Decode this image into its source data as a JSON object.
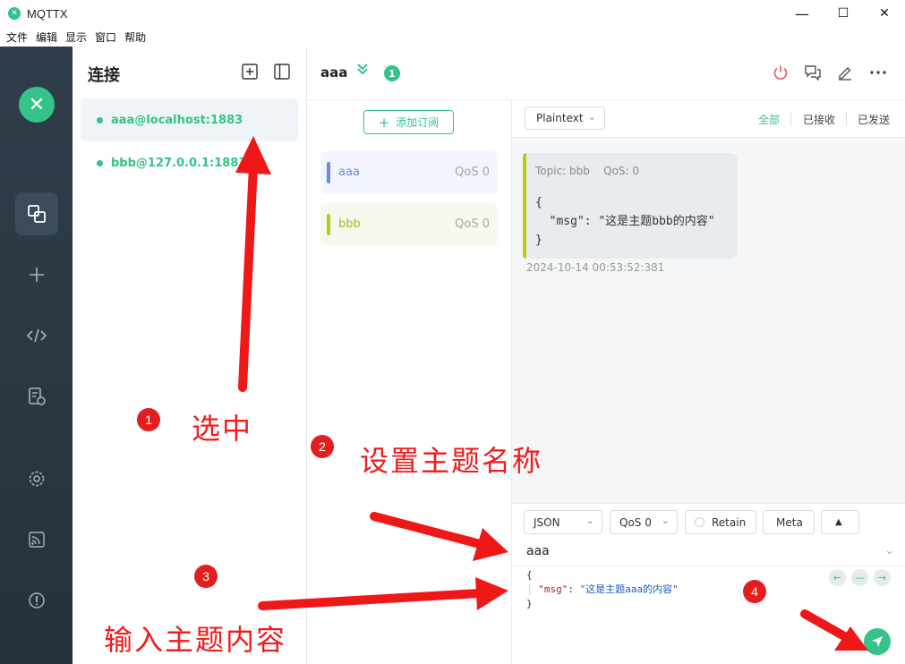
{
  "window": {
    "title": "MQTTX",
    "minimize": "—",
    "maximize": "☐",
    "close": "✕"
  },
  "menu": [
    "文件",
    "编辑",
    "显示",
    "窗口",
    "帮助"
  ],
  "nav": {
    "logo": "✕",
    "items": [
      "connections-icon",
      "plus-icon",
      "code-icon",
      "log-icon",
      "gear-icon",
      "rss-icon",
      "info-icon"
    ]
  },
  "connections": {
    "title": "连接",
    "items": [
      {
        "label": "aaa@localhost:1883",
        "selected": true
      },
      {
        "label": "bbb@127.0.0.1:1883",
        "selected": false
      }
    ]
  },
  "header": {
    "name": "aaa",
    "badge": "1"
  },
  "subscriptions": {
    "add_label": "添加订阅",
    "items": [
      {
        "topic": "aaa",
        "qos": "QoS 0",
        "color": "#6b8dd6",
        "bg": "#f2f5fb",
        "text_color": "#6b8dd6"
      },
      {
        "topic": "bbb",
        "qos": "QoS 0",
        "color": "#b9cc18",
        "bg": "#f7f9ee",
        "text_color": "#a7b91a"
      }
    ]
  },
  "messages": {
    "format": "Plaintext",
    "filters": {
      "all": "全部",
      "received": "已接收",
      "sent": "已发送"
    },
    "items": [
      {
        "meta": "Topic: bbb    QoS: 0",
        "body": "{\n  \"msg\": \"这是主题bbb的内容\"\n}",
        "time": "2024-10-14 00:53:52:381"
      }
    ]
  },
  "publish": {
    "format": "JSON",
    "qos": "QoS 0",
    "retain": "Retain",
    "meta": "Meta",
    "expand": "▲",
    "topic": "aaa",
    "payload_open": "{",
    "payload_key": "\"msg\"",
    "payload_colon": ": ",
    "payload_value": "\"这是主题aaa的内容\"",
    "payload_close": "}"
  },
  "annotations": {
    "n1": "1",
    "t1": "选中",
    "n2": "2",
    "t2": "设置主题名称",
    "n3": "3",
    "t3": "输入主题内容",
    "n4": "4"
  }
}
